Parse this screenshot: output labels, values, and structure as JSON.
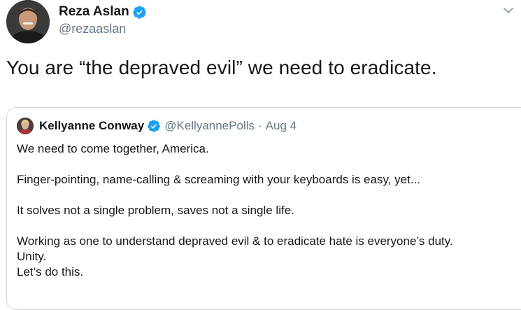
{
  "tweet": {
    "author_name": "Reza Aslan",
    "author_handle": "@rezaaslan",
    "text": "You are “the depraved evil” we need to eradicate."
  },
  "quoted_tweet": {
    "author_name": "Kellyanne Conway",
    "author_handle": "@KellyannePolls",
    "separator": "·",
    "date": "Aug 4",
    "lines": {
      "l1": "We need to come together, America.",
      "l2": "Finger-pointing, name-calling & screaming with your keyboards is easy, yet...",
      "l3": "It solves not a single problem, saves not a single life.",
      "l4": "Working as one to understand depraved evil & to eradicate hate is everyone’s duty.",
      "l5": "Unity.",
      "l6": "Let’s do this."
    }
  },
  "icons": {
    "verified": "verified-badge-icon",
    "more": "chevron-down-icon"
  },
  "colors": {
    "text": "#14171a",
    "secondary": "#657786",
    "verified_blue": "#1da1f2",
    "border": "#ccd6dd"
  }
}
